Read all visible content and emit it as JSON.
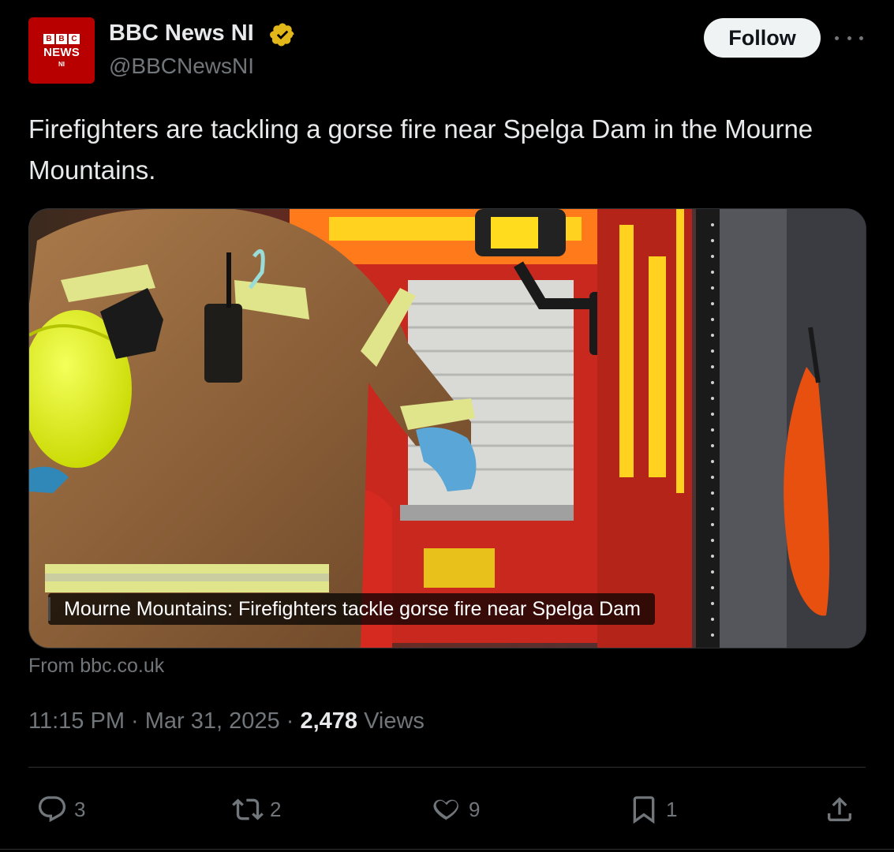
{
  "account": {
    "display_name": "BBC News NI",
    "handle": "@BBCNewsNI",
    "avatar": {
      "bbc_letters": [
        "B",
        "B",
        "C"
      ],
      "news": "NEWS",
      "region": "NI",
      "color": "#b80000"
    },
    "verified_badge_color": "#e2b719"
  },
  "follow_label": "Follow",
  "tweet_text": "Firefighters are tackling a gorse fire near Spelga Dam in the Mourne Mountains.",
  "media": {
    "caption": "Mourne Mountains: Firefighters tackle gorse fire near Spelga Dam",
    "source": "From bbc.co.uk"
  },
  "meta": {
    "time": "11:15 PM",
    "date": "Mar 31, 2025",
    "views_count": "2,478",
    "views_label": "Views"
  },
  "actions": {
    "replies": "3",
    "reposts": "2",
    "likes": "9",
    "bookmarks": "1"
  },
  "icons": [
    "more-icon",
    "verified-icon",
    "reply-icon",
    "repost-icon",
    "like-icon",
    "bookmark-icon",
    "share-icon"
  ]
}
